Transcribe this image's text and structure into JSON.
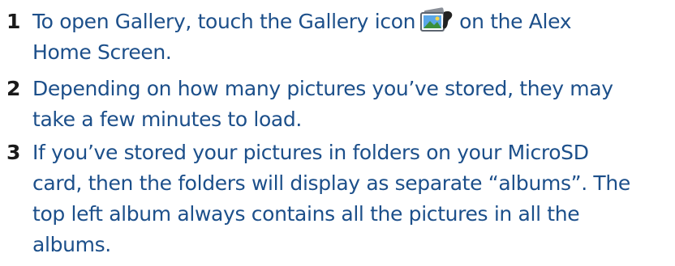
{
  "steps": [
    {
      "number": "1",
      "lines": [
        "To open Gallery, touch the Gallery icon",
        "on the Alex",
        "Home Screen."
      ],
      "icon": "gallery-icon"
    },
    {
      "number": "2",
      "lines": [
        "Depending on how many pictures you’ve stored, they may",
        "take a few minutes to load."
      ]
    },
    {
      "number": "3",
      "lines": [
        "If you’ve stored your pictures in folders on your MicroSD",
        "card, then the folders will display as separate “albums”. The",
        "top left album always contains all the pictures in all the",
        "albums."
      ]
    }
  ],
  "colors": {
    "body_text": "#1c4f8a",
    "step_number": "#1a1a1a"
  }
}
